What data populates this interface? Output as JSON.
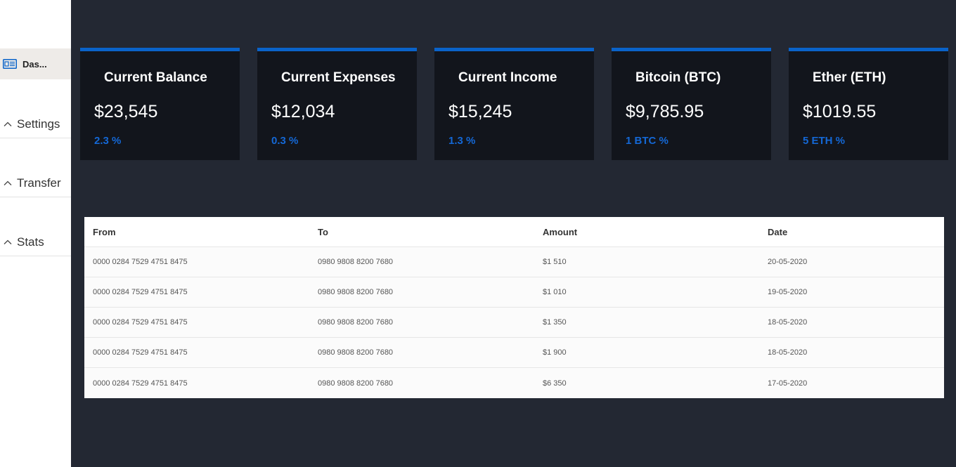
{
  "sidebar": {
    "active_item": {
      "label": "Das...",
      "icon": "dashboard-icon"
    },
    "groups": [
      {
        "label": "Settings",
        "icon": "chevron-up-icon"
      },
      {
        "label": "Transfer",
        "icon": "chevron-up-icon"
      },
      {
        "label": "Stats",
        "icon": "chevron-up-icon"
      }
    ]
  },
  "cards": [
    {
      "title": "Current Balance",
      "value": "$23,545",
      "change": "2.3 %"
    },
    {
      "title": "Current Expenses",
      "value": "$12,034",
      "change": "0.3 %"
    },
    {
      "title": "Current Income",
      "value": "$15,245",
      "change": "1.3 %"
    },
    {
      "title": "Bitcoin (BTC)",
      "value": "$9,785.95",
      "change": "1 BTC %"
    },
    {
      "title": "Ether (ETH)",
      "value": "$1019.55",
      "change": "5 ETH %"
    }
  ],
  "table": {
    "headers": [
      "From",
      "To",
      "Amount",
      "Date"
    ],
    "rows": [
      [
        "0000 0284 7529 4751 8475",
        "0980 9808 8200 7680",
        "$1 510",
        "20-05-2020"
      ],
      [
        "0000 0284 7529 4751 8475",
        "0980 9808 8200 7680",
        "$1 010",
        "19-05-2020"
      ],
      [
        "0000 0284 7529 4751 8475",
        "0980 9808 8200 7680",
        "$1 350",
        "18-05-2020"
      ],
      [
        "0000 0284 7529 4751 8475",
        "0980 9808 8200 7680",
        "$1 900",
        "18-05-2020"
      ],
      [
        "0000 0284 7529 4751 8475",
        "0980 9808 8200 7680",
        "$6 350",
        "17-05-2020"
      ]
    ]
  },
  "colors": {
    "accent": "#0a63c9",
    "background": "#232833",
    "card": "#12151c"
  }
}
